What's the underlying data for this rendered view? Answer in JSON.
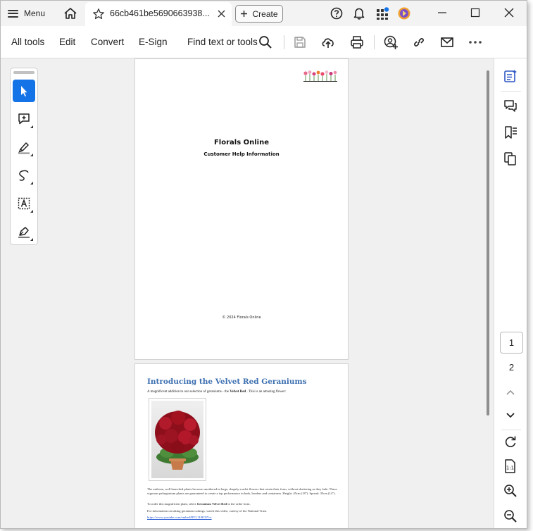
{
  "titlebar": {
    "menu_label": "Menu",
    "tab_title": "66cb461be5690663938...",
    "create_label": "Create"
  },
  "toolbar": {
    "all_tools": "All tools",
    "edit": "Edit",
    "convert": "Convert",
    "esign": "E-Sign",
    "find": "Find text or tools"
  },
  "left_tools": [
    "select-tool",
    "add-comment-tool",
    "highlight-tool",
    "draw-tool",
    "text-recognition-tool",
    "sign-tool"
  ],
  "page1": {
    "title": "Florals Online",
    "subtitle": "Customer Help Information",
    "copyright": "© 2024 Florals Online"
  },
  "page2": {
    "title": "Introducing the Velvet Red Geraniums",
    "intro_prefix": "A magnificent addition to our selection of geraniums - the ",
    "intro_bold": "Velvet Red",
    "intro_suffix": " . This is an amazing flower:",
    "para1": "The uniform, well branched plants become smothered in large, shapely scarlet flowers that retain their form, without shattering as they fade. These vigorous pelargonium plants are guaranteed to create a top performance in beds, borders and containers. Height: 45cm (18\"). Spread: 35cm (14\").",
    "order_prefix": "To order this magnificent plant, select ",
    "order_bold": "Geranium Velvet Red",
    "order_suffix": " in the order form.",
    "video_text": "For information on taking geranium cuttings, watch this video, curtesy of the National Trust.",
    "video_link": "https://www.youtube.com/embed/RYL1LBO5Vw"
  },
  "pager": {
    "current": "1",
    "next": "2"
  },
  "colors": {
    "accent": "#1473e6",
    "link": "#1a4fd0",
    "page2_title": "#3c6fb0"
  }
}
